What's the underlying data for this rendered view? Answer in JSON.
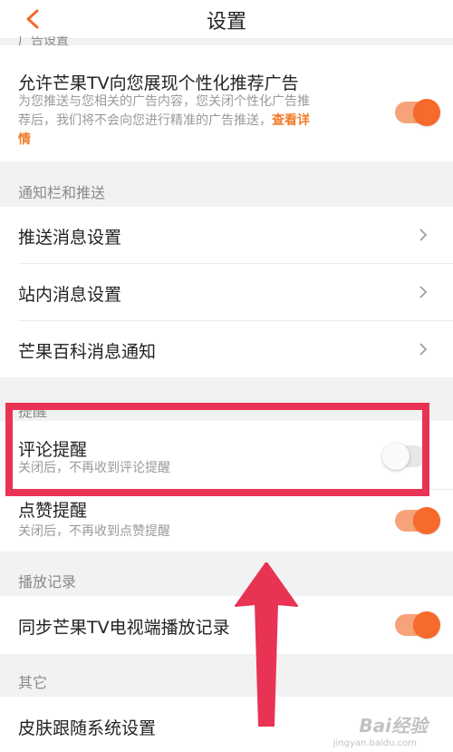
{
  "header": {
    "title": "设置",
    "back_icon": "chevron-left-icon"
  },
  "ad_section": {
    "label_cut": "广告设置",
    "title": "允许芒果TV向您展现个性化推荐广告",
    "desc_line1": "为您推送与您相关的广告内容，您关闭个性化广告推",
    "desc_line2_pre": "荐后，我们将不会向您进行精准的广告推送，",
    "desc_link": "查看详",
    "desc_line3": "情",
    "toggle_on": true
  },
  "notify_section": {
    "label": "通知栏和推送",
    "items": [
      {
        "label": "推送消息设置"
      },
      {
        "label": "站内消息设置"
      },
      {
        "label": "芒果百科消息通知"
      }
    ]
  },
  "remind_section": {
    "label_cut": "提醒",
    "comment": {
      "title": "评论提醒",
      "desc": "关闭后，不再收到评论提醒",
      "toggle_on": false
    },
    "like": {
      "title_cut": "点赞提醒",
      "desc": "关闭后，不再收到点赞提醒",
      "toggle_on": true
    }
  },
  "history_section": {
    "label": "播放记录",
    "item": {
      "label": "同步芒果TV电视端播放记录",
      "toggle_on": true
    }
  },
  "other_section": {
    "label": "其它",
    "item": {
      "label": "皮肤跟随系统设置"
    }
  },
  "watermark": {
    "text": "Bai经验",
    "url": "jingyan.baidu.com"
  },
  "colors": {
    "accent": "#f66a2b",
    "highlight": "#e83355"
  }
}
